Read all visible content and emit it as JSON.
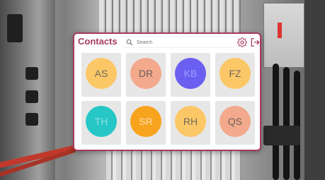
{
  "app": {
    "title": "Contacts",
    "accent": "#a83a62"
  },
  "search": {
    "placeholder": "Search",
    "icon": "search-icon"
  },
  "header_icons": [
    {
      "name": "gear-icon"
    },
    {
      "name": "logout-icon"
    }
  ],
  "contacts": [
    {
      "initials": "AS",
      "name": "",
      "color": "#fcc766",
      "text_color": "#6f6a60"
    },
    {
      "initials": "DR",
      "name": "",
      "color": "#f2a98c",
      "text_color": "#6b5f5a"
    },
    {
      "initials": "KB",
      "name": "",
      "color": "#6a5ff0",
      "text_color": "#9aa0ff"
    },
    {
      "initials": "FZ",
      "name": "",
      "color": "#fcc766",
      "text_color": "#6f6a60"
    },
    {
      "initials": "TH",
      "name": "",
      "color": "#27c7c7",
      "text_color": "#8de0e0"
    },
    {
      "initials": "SR",
      "name": "",
      "color": "#f7a31d",
      "text_color": "#ffe0b0"
    },
    {
      "initials": "RH",
      "name": "",
      "color": "#fcc766",
      "text_color": "#6f6a60"
    },
    {
      "initials": "QS",
      "name": "",
      "color": "#f2a98c",
      "text_color": "#6b5f5a"
    }
  ]
}
